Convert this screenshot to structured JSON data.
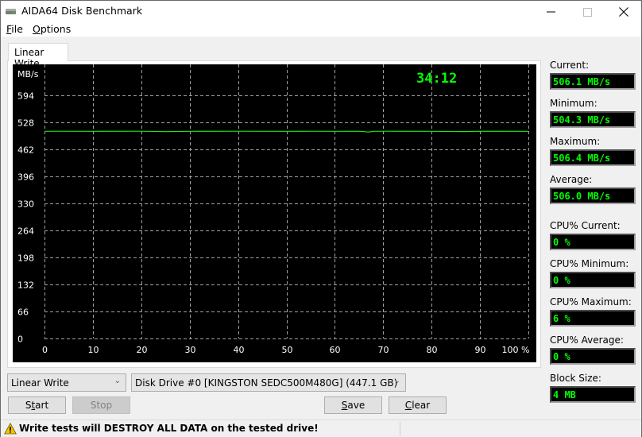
{
  "window": {
    "title": "AIDA64 Disk Benchmark",
    "icon": "disk-drive-icon",
    "controls": {
      "minimize": "minimize-icon",
      "maximize": "maximize-icon",
      "close": "close-icon"
    }
  },
  "menu": {
    "items": [
      {
        "label": "File",
        "accel": "F",
        "rest": "ile"
      },
      {
        "label": "Options",
        "accel": "O",
        "rest": "ptions"
      }
    ]
  },
  "tabs": [
    {
      "label": "Linear Write",
      "active": true
    }
  ],
  "chart_data": {
    "type": "line",
    "title": "",
    "ylabel": "MB/s",
    "xlabel": "",
    "timer": "34:12",
    "ylim": [
      0,
      594
    ],
    "xlim": [
      0,
      100
    ],
    "y_ticks": [
      0,
      66,
      132,
      198,
      264,
      330,
      396,
      462,
      528,
      594
    ],
    "y_tick_labels": [
      "0",
      "66",
      "132",
      "198",
      "264",
      "330",
      "396",
      "462",
      "528",
      "594"
    ],
    "x_ticks": [
      0,
      10,
      20,
      30,
      40,
      50,
      60,
      70,
      80,
      90,
      100
    ],
    "x_tick_labels": [
      "0",
      "10",
      "20",
      "30",
      "40",
      "50",
      "60",
      "70",
      "80",
      "90",
      "100 %"
    ],
    "grid": true,
    "series": [
      {
        "name": "Linear Write",
        "color": "#1ee61e",
        "x": [
          0,
          2,
          10,
          20,
          25,
          30,
          40,
          50,
          55,
          60,
          65,
          67,
          68,
          70,
          80,
          87,
          90,
          100
        ],
        "values": [
          506.1,
          506.2,
          506.1,
          506.2,
          505.3,
          506.1,
          506.2,
          506.1,
          506.2,
          506.1,
          506.2,
          504.3,
          506.1,
          506.2,
          506.1,
          505.5,
          506.2,
          506.1
        ]
      }
    ]
  },
  "stats": [
    {
      "label": "Current:",
      "value": "506.1 MB/s"
    },
    {
      "label": "Minimum:",
      "value": "504.3 MB/s"
    },
    {
      "label": "Maximum:",
      "value": "506.4 MB/s"
    },
    {
      "label": "Average:",
      "value": "506.0 MB/s"
    },
    {
      "label": "CPU% Current:",
      "value": "0 %"
    },
    {
      "label": "CPU% Minimum:",
      "value": "0 %"
    },
    {
      "label": "CPU% Maximum:",
      "value": "6 %"
    },
    {
      "label": "CPU% Average:",
      "value": "0 %"
    },
    {
      "label": "Block Size:",
      "value": "4 MB"
    }
  ],
  "controls": {
    "test_select": "Linear Write",
    "drive_select": "Disk Drive #0  [KINGSTON SEDC500M480G]  (447.1 GB)",
    "start": {
      "pre": "S",
      "accel": "t",
      "post": "art"
    },
    "stop": "Stop",
    "save": {
      "accel": "S",
      "post": "ave"
    },
    "clear": {
      "accel": "C",
      "post": "lear"
    }
  },
  "status": {
    "warning": "Write tests will DESTROY ALL DATA on the tested drive!",
    "icon": "warning-icon"
  },
  "colors": {
    "accent_green": "#00ff00",
    "line_green": "#1ee61e",
    "grid": "#a0a0a0"
  }
}
